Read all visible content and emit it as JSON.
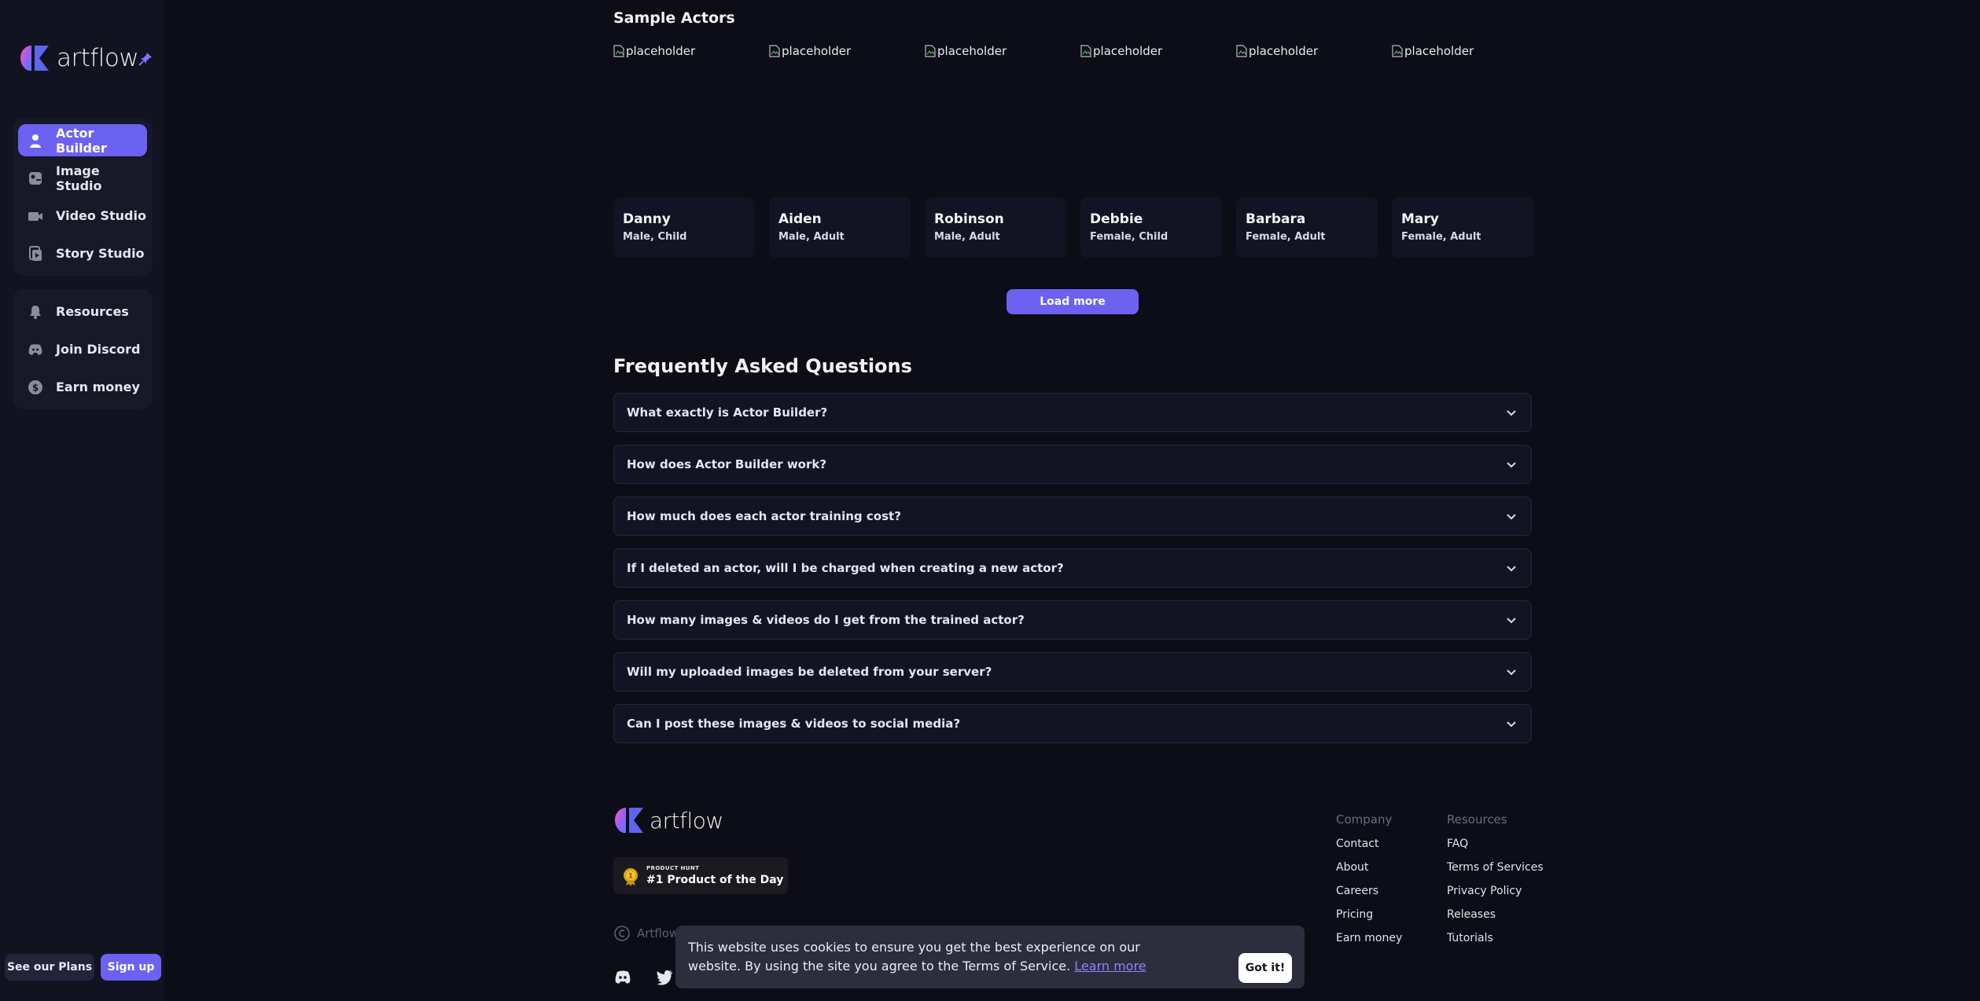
{
  "brand": {
    "name": "artflow"
  },
  "sidebar": {
    "group1": [
      {
        "label": "Actor Builder",
        "icon": "person-icon",
        "active": true
      },
      {
        "label": "Image Studio",
        "icon": "image-studio-icon",
        "active": false
      },
      {
        "label": "Video Studio",
        "icon": "video-camera-icon",
        "active": false
      },
      {
        "label": "Story Studio",
        "icon": "story-icon",
        "active": false
      }
    ],
    "group2": [
      {
        "label": "Resources",
        "icon": "bell-icon"
      },
      {
        "label": "Join Discord",
        "icon": "discord-icon"
      },
      {
        "label": "Earn money",
        "icon": "dollar-icon"
      }
    ],
    "plans_label": "See our Plans",
    "signup_label": "Sign up"
  },
  "sample_actors": {
    "title": "Sample Actors",
    "image_alt": "placeholder",
    "items": [
      {
        "name": "Danny",
        "meta": "Male, Child"
      },
      {
        "name": "Aiden",
        "meta": "Male, Adult"
      },
      {
        "name": "Robinson",
        "meta": "Male, Adult"
      },
      {
        "name": "Debbie",
        "meta": "Female, Child"
      },
      {
        "name": "Barbara",
        "meta": "Female, Adult"
      },
      {
        "name": "Mary",
        "meta": "Female, Adult"
      }
    ],
    "load_more_label": "Load more"
  },
  "faq": {
    "title": "Frequently Asked Questions",
    "items": [
      "What exactly is Actor Builder?",
      "How does Actor Builder work?",
      "How much does each actor training cost?",
      "If I deleted an actor, will I be charged when creating a new actor?",
      "How many images & videos do I get from the trained actor?",
      "Will my uploaded images be deleted from your server?",
      "Can I post these images & videos to social media?"
    ]
  },
  "footer": {
    "badge_small": "PRODUCT HUNT",
    "badge_big": "#1 Product of the Day",
    "copyright": "Artflow",
    "company_head": "Company",
    "company_links": [
      "Contact",
      "About",
      "Careers",
      "Pricing",
      "Earn money"
    ],
    "resources_head": "Resources",
    "resources_links": [
      "FAQ",
      "Terms of Services",
      "Privacy Policy",
      "Releases",
      "Tutorials"
    ]
  },
  "cookie": {
    "text": "This website uses cookies to ensure you get the best experience on our website. By using the site you agree to the Terms of Service.",
    "link": "Learn more",
    "button": "Got it!"
  },
  "colors": {
    "accent": "#6b62f2",
    "background": "#0c0d17",
    "sidebar": "#121321"
  }
}
